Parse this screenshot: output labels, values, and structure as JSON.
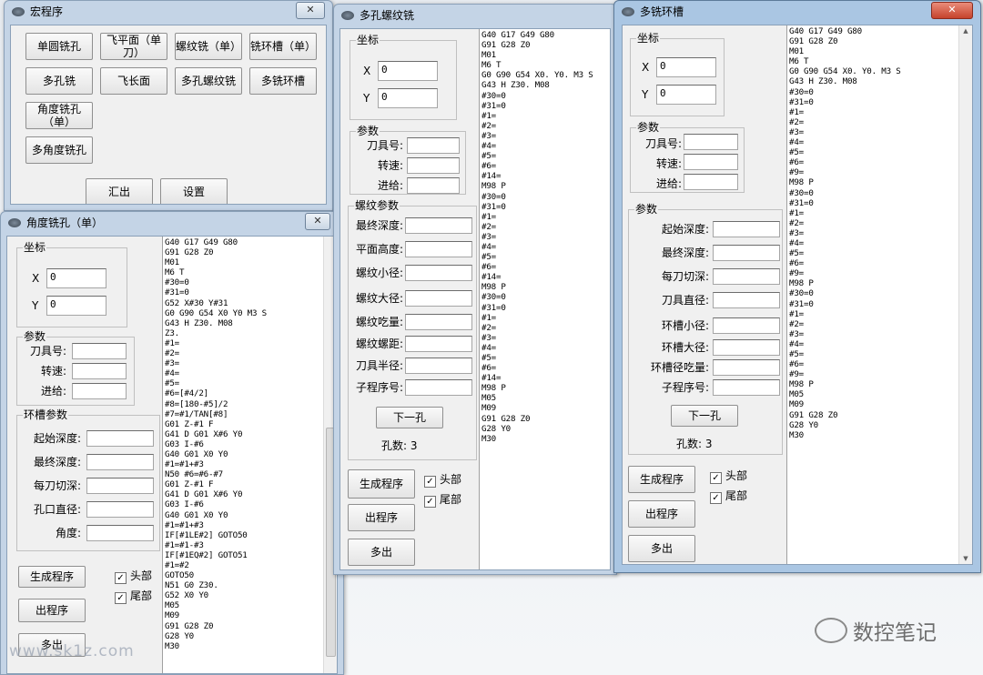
{
  "background": {
    "watermark_site": "www.sk1z.com",
    "watermark_brand": "数控笔记"
  },
  "win_macro": {
    "title": "宏程序",
    "close": "✕",
    "buttons": [
      "单圆铣孔",
      "飞平面（单刀）",
      "螺纹铣（单）",
      "铣环槽（单）",
      "多孔铣",
      "飞长面",
      "多孔螺纹铣",
      "多铣环槽",
      "角度铣孔（单）",
      "多角度铣孔",
      "汇出",
      "设置"
    ]
  },
  "win_angle": {
    "title": "角度铣孔（单）",
    "close": "✕",
    "coord_group": "坐标",
    "x_label": "X",
    "x_value": "0",
    "y_label": "Y",
    "y_value": "0",
    "param_group": "参数",
    "param_labels": [
      "刀具号:",
      "转速:",
      "进给:"
    ],
    "groove_group": "环槽参数",
    "groove_labels": [
      "起始深度:",
      "最终深度:",
      "每刀切深:",
      "孔口直径:",
      "角度:"
    ],
    "btn_generate": "生成程序",
    "btn_output": "出程序",
    "btn_multi": "多出",
    "chk_head": "头部",
    "chk_tail": "尾部",
    "chk_mark": "✓",
    "code": "G40 G17 G49 G80\nG91 G28 Z0\nM01\nM6 T\n#30=0\n#31=0\nG52 X#30 Y#31\nG0 G90 G54 X0 Y0 M3 S\nG43 H Z30. M08\nZ3.\n#1=\n#2=\n#3=\n#4=\n#5=\n#6=[#4/2]\n#8=[180-#5]/2\n#7=#1/TAN[#8]\nG01 Z-#1 F\nG41 D G01 X#6 Y0\nG03 I-#6\nG40 G01 X0 Y0\n#1=#1+#3\nN50 #6=#6-#7\nG01 Z-#1 F\nG41 D G01 X#6 Y0\nG03 I-#6\nG40 G01 X0 Y0\n#1=#1+#3\nIF[#1LE#2] GOTO50\n#1=#1-#3\nIF[#1EQ#2] GOTO51\n#1=#2\nGOTO50\nN51 G0 Z30.\nG52 X0 Y0\nM05\nM09\nG91 G28 Z0\nG28 Y0\nM30"
  },
  "win_thread": {
    "title": "多孔螺纹铣",
    "coord_group": "坐标",
    "x_label": "X",
    "x_value": "0",
    "y_label": "Y",
    "y_value": "0",
    "param_group": "参数",
    "param_labels": [
      "刀具号:",
      "转速:",
      "进给:"
    ],
    "thread_group": "螺纹参数",
    "thread_labels": [
      "最终深度:",
      "平面高度:",
      "螺纹小径:",
      "螺纹大径:",
      "螺纹吃量:",
      "螺纹螺距:",
      "刀具半径:",
      "子程序号:"
    ],
    "btn_next": "下一孔",
    "hole_count": "孔数: 3",
    "btn_generate": "生成程序",
    "btn_output": "出程序",
    "btn_multi": "多出",
    "chk_head": "头部",
    "chk_tail": "尾部",
    "chk_mark": "✓",
    "code": "G40 G17 G49 G80\nG91 G28 Z0\nM01\nM6 T\nG0 G90 G54 X0. Y0. M3 S\nG43 H Z30. M08\n#30=0\n#31=0\n#1=\n#2=\n#3=\n#4=\n#5=\n#6=\n#14=\nM98 P\n#30=0\n#31=0\n#1=\n#2=\n#3=\n#4=\n#5=\n#6=\n#14=\nM98 P\n#30=0\n#31=0\n#1=\n#2=\n#3=\n#4=\n#5=\n#6=\n#14=\nM98 P\nM05\nM09\nG91 G28 Z0\nG28 Y0\nM30"
  },
  "win_ring": {
    "title": "多铣环槽",
    "close": "✕",
    "coord_group": "坐标",
    "x_label": "X",
    "x_value": "0",
    "y_label": "Y",
    "y_value": "0",
    "param_group": "参数",
    "param_labels": [
      "刀具号:",
      "转速:",
      "进给:"
    ],
    "ring_group": "参数",
    "ring_labels": [
      "起始深度:",
      "最终深度:",
      "每刀切深:",
      "刀具直径:",
      "环槽小径:",
      "环槽大径:",
      "环槽径吃量:",
      "子程序号:"
    ],
    "btn_next": "下一孔",
    "hole_count": "孔数: 3",
    "btn_generate": "生成程序",
    "btn_output": "出程序",
    "btn_multi": "多出",
    "chk_head": "头部",
    "chk_tail": "尾部",
    "chk_mark": "✓",
    "scroll_up": "▲",
    "scroll_down": "▼",
    "code": "G40 G17 G49 G80\nG91 G28 Z0\nM01\nM6 T\nG0 G90 G54 X0. Y0. M3 S\nG43 H Z30. M08\n#30=0\n#31=0\n#1=\n#2=\n#3=\n#4=\n#5=\n#6=\n#9=\nM98 P\n#30=0\n#31=0\n#1=\n#2=\n#3=\n#4=\n#5=\n#6=\n#9=\nM98 P\n#30=0\n#31=0\n#1=\n#2=\n#3=\n#4=\n#5=\n#6=\n#9=\nM98 P\nM05\nM09\nG91 G28 Z0\nG28 Y0\nM30"
  }
}
